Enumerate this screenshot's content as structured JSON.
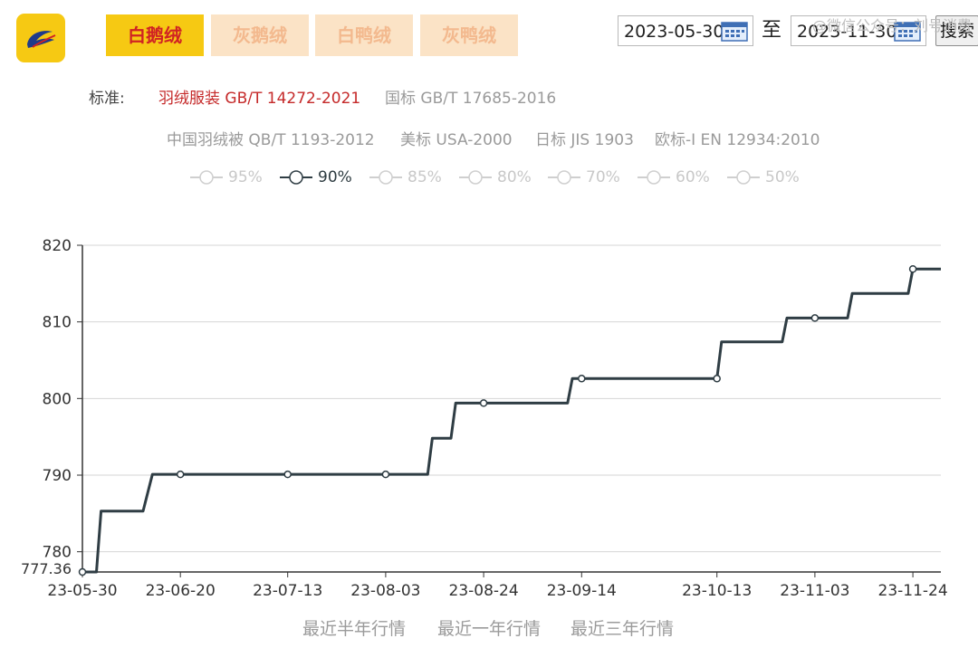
{
  "logo_icon": "quill-logo-icon",
  "tabs": [
    {
      "label": "白鹅绒",
      "active": true
    },
    {
      "label": "灰鹅绒",
      "active": false
    },
    {
      "label": "白鸭绒",
      "active": false
    },
    {
      "label": "灰鸭绒",
      "active": false
    }
  ],
  "date_range": {
    "start": "2023-05-30",
    "separator": "至",
    "end": "2023-11-30",
    "search_label": "搜索",
    "calendar_icon": "calendar-icon"
  },
  "watermark": "@微信公众号：刘号消费",
  "standards": {
    "label": "标准:",
    "items": [
      {
        "label": "羽绒服装 GB/T 14272-2021",
        "active": true
      },
      {
        "label": "国标 GB/T 17685-2016",
        "active": false
      },
      {
        "label": "中国羽绒被 QB/T 1193-2012",
        "active": false
      },
      {
        "label": "美标 USA-2000",
        "active": false
      },
      {
        "label": "日标 JIS 1903",
        "active": false
      },
      {
        "label": "欧标-I EN 12934:2010",
        "active": false
      }
    ]
  },
  "percent_options": [
    {
      "label": "95%",
      "active": false
    },
    {
      "label": "90%",
      "active": true
    },
    {
      "label": "85%",
      "active": false
    },
    {
      "label": "80%",
      "active": false
    },
    {
      "label": "70%",
      "active": false
    },
    {
      "label": "60%",
      "active": false
    },
    {
      "label": "50%",
      "active": false
    }
  ],
  "range_links": [
    "最近半年行情",
    "最近一年行情",
    "最近三年行情"
  ],
  "colors": {
    "accent": "#f6c913",
    "active_text": "#d02323",
    "line": "#2f3d44",
    "grid": "#d6d6d6"
  },
  "chart_data": {
    "type": "line",
    "step": true,
    "grid": true,
    "ylim": [
      777.36,
      820
    ],
    "yticks": [
      780,
      790,
      800,
      810,
      820
    ],
    "ymin_label": "777.36",
    "x_start": "2023-05-30",
    "x_end": "2023-11-30",
    "xticks": [
      "23-05-30",
      "23-06-20",
      "23-07-13",
      "23-08-03",
      "23-08-24",
      "23-09-14",
      "23-10-13",
      "23-11-03",
      "23-11-24"
    ],
    "series": [
      {
        "name": "90%",
        "points": [
          {
            "x": "2023-05-30",
            "y": 777.36
          },
          {
            "x": "2023-06-02",
            "y": 777.36
          },
          {
            "x": "2023-06-03",
            "y": 785.3
          },
          {
            "x": "2023-06-12",
            "y": 785.3
          },
          {
            "x": "2023-06-14",
            "y": 790.1
          },
          {
            "x": "2023-06-20",
            "y": 790.1
          },
          {
            "x": "2023-07-13",
            "y": 790.1
          },
          {
            "x": "2023-08-03",
            "y": 790.1
          },
          {
            "x": "2023-08-12",
            "y": 790.1
          },
          {
            "x": "2023-08-13",
            "y": 794.8
          },
          {
            "x": "2023-08-17",
            "y": 794.8
          },
          {
            "x": "2023-08-18",
            "y": 799.4
          },
          {
            "x": "2023-08-24",
            "y": 799.4
          },
          {
            "x": "2023-09-11",
            "y": 799.4
          },
          {
            "x": "2023-09-12",
            "y": 802.6
          },
          {
            "x": "2023-09-14",
            "y": 802.6
          },
          {
            "x": "2023-10-13",
            "y": 802.6
          },
          {
            "x": "2023-10-14",
            "y": 807.4
          },
          {
            "x": "2023-10-27",
            "y": 807.4
          },
          {
            "x": "2023-10-28",
            "y": 810.5
          },
          {
            "x": "2023-11-03",
            "y": 810.5
          },
          {
            "x": "2023-11-10",
            "y": 810.5
          },
          {
            "x": "2023-11-11",
            "y": 813.7
          },
          {
            "x": "2023-11-23",
            "y": 813.7
          },
          {
            "x": "2023-11-24",
            "y": 816.9
          },
          {
            "x": "2023-11-30",
            "y": 816.9
          }
        ],
        "markers": [
          "2023-05-30",
          "2023-06-20",
          "2023-07-13",
          "2023-08-03",
          "2023-08-24",
          "2023-09-14",
          "2023-10-13",
          "2023-11-03",
          "2023-11-24"
        ]
      }
    ]
  }
}
